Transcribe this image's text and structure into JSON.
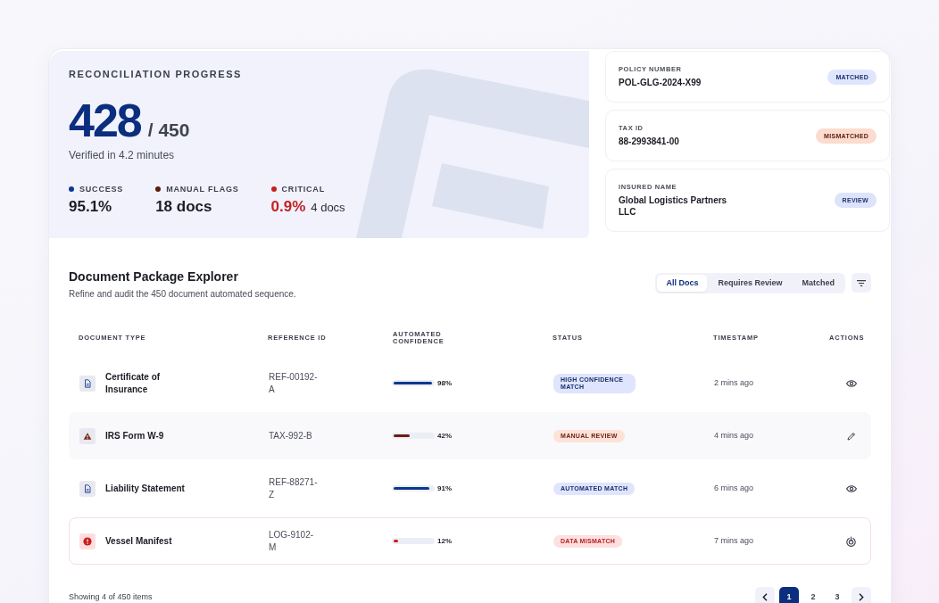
{
  "hero": {
    "title": "RECONCILIATION PROGRESS",
    "count": "428",
    "total": "/ 450",
    "subtitle": "Verified in 4.2 minutes",
    "stats": [
      {
        "kind": "default",
        "label": "SUCCESS",
        "color": "#0b3a8c",
        "value": "95.1%"
      },
      {
        "kind": "default",
        "label": "MANUAL FLAGS",
        "color": "#5c1a0a",
        "value": "18 docs"
      },
      {
        "kind": "critical",
        "label": "CRITICAL",
        "color": "#c42121",
        "value": "0.9%",
        "detail": "4 docs"
      }
    ]
  },
  "fields": [
    {
      "kind": "match",
      "label": "POLICY NUMBER",
      "value": "POL-GLG-2024-X99",
      "status": "MATCHED"
    },
    {
      "kind": "mismatch",
      "label": "TAX ID",
      "value": "88-2993841-00",
      "status": "MISMATCHED"
    },
    {
      "kind": "review",
      "label": "INSURED NAME",
      "value": "Global Logistics Partners LLC",
      "status": "REVIEW"
    }
  ],
  "explorer": {
    "title": "Document Package Explorer",
    "subtitle": "Refine and audit the 450 document automated sequence.",
    "tabs": [
      {
        "label": "All Docs",
        "selected": true
      },
      {
        "label": "Requires Review",
        "selected": false
      },
      {
        "label": "Matched",
        "selected": false
      }
    ]
  },
  "table": {
    "columns": [
      "DOCUMENT TYPE",
      "REFERENCE ID",
      "AUTOMATED CONFIDENCE",
      "STATUS",
      "TIMESTAMP",
      "ACTIONS"
    ],
    "rows": [
      {
        "kind": "document",
        "name": "Certificate of Insurance",
        "reference": "REF-00192-A",
        "level": 0.98,
        "confidence": "98%",
        "status": "HIGH CONFIDENCE MATCH",
        "time": "2 mins ago"
      },
      {
        "kind": "warning",
        "name": "IRS Form W-9",
        "reference": "TAX-992-B",
        "level": 0.42,
        "confidence": "42%",
        "status": "MANUAL REVIEW",
        "time": "4 mins ago"
      },
      {
        "kind": "document",
        "name": "Liability Statement",
        "reference": "REF-88271-Z",
        "level": 0.91,
        "confidence": "91%",
        "status": "AUTOMATED MATCH",
        "time": "6 mins ago"
      },
      {
        "kind": "error",
        "name": "Vessel Manifest",
        "reference": "LOG-9102-M",
        "level": 0.12,
        "confidence": "12%",
        "status": "DATA MISMATCH",
        "time": "7 mins ago"
      }
    ]
  },
  "footer": {
    "summary": "Showing 4 of 450 items",
    "pages": [
      {
        "label": "1",
        "selected": true
      },
      {
        "label": "2",
        "selected": false
      },
      {
        "label": "3",
        "selected": false
      }
    ]
  }
}
